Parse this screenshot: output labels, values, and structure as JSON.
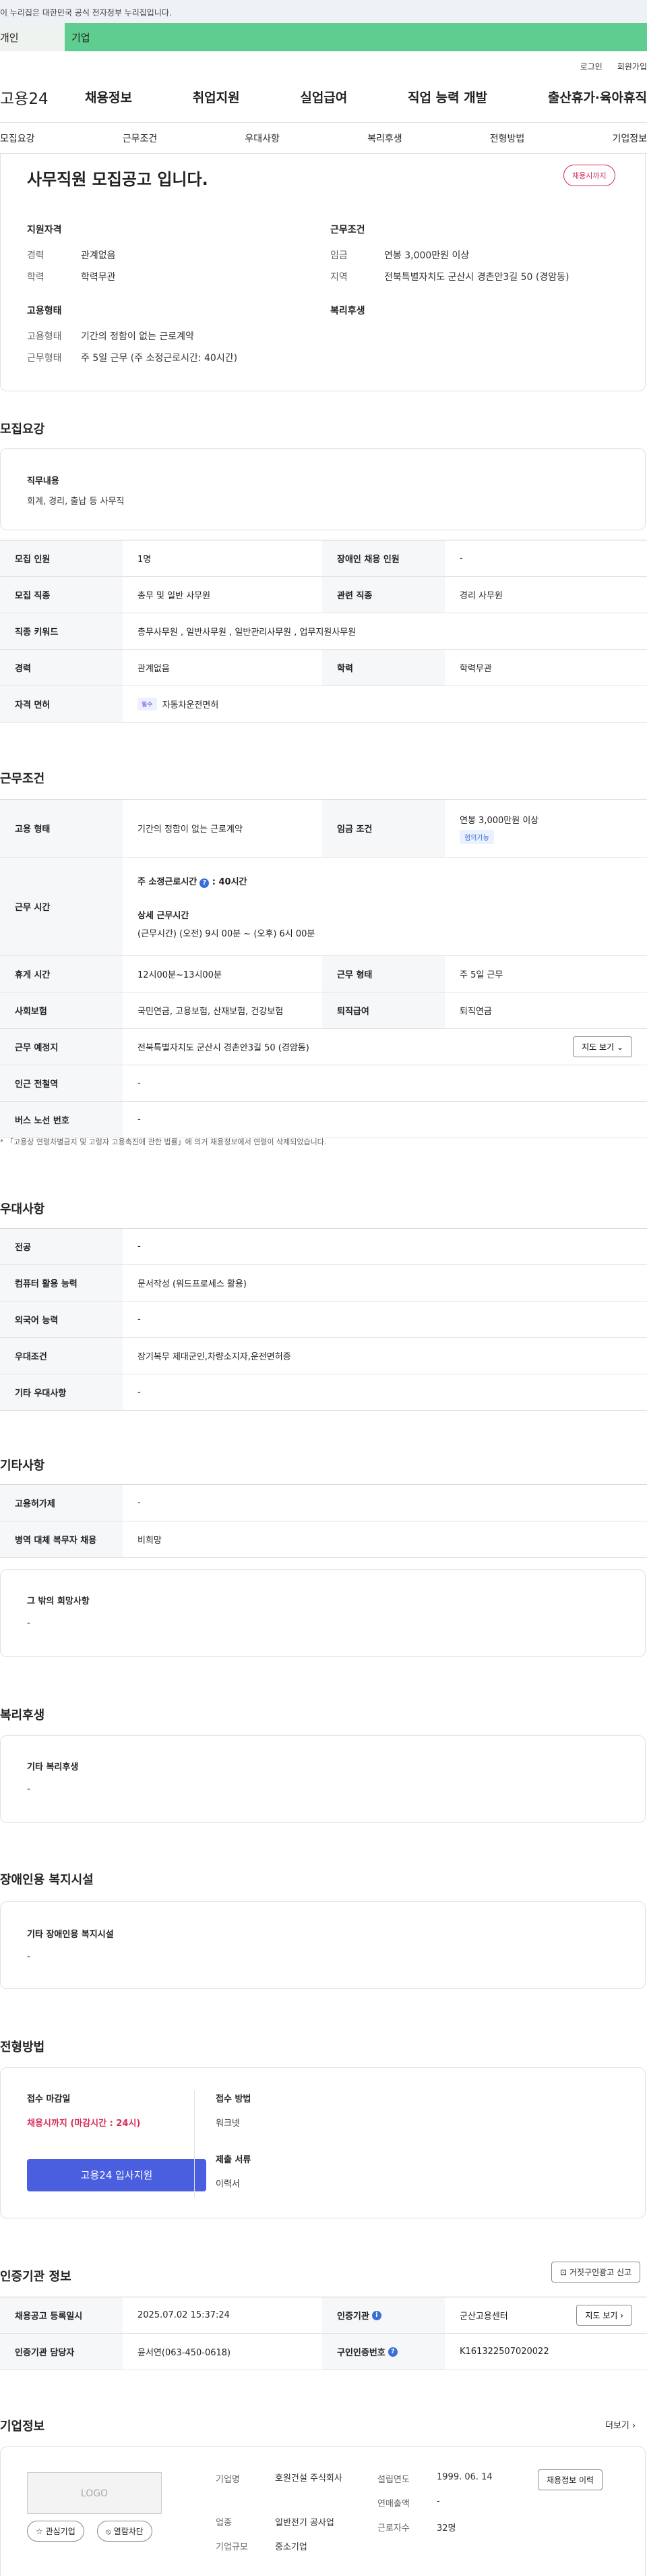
{
  "gov_banner": "이 누리집은 대한민국 공식 전자정부 누리집입니다.",
  "gov_bar": {
    "a": "개인",
    "b": "기업"
  },
  "util": {
    "login": "로그인",
    "join": "회원가입"
  },
  "gnb": {
    "logo": "고용24",
    "items": [
      "채용정보",
      "취업지원",
      "실업급여",
      "직업 능력 개발",
      "출산휴가·육아휴직"
    ]
  },
  "tabs": [
    "모집요강",
    "근무조건",
    "우대사항",
    "복리후생",
    "전형방법",
    "기업정보"
  ],
  "summary": {
    "title": "사무직원 모집공고 입니다.",
    "badge": "채용시까지",
    "qual_title": "지원자격",
    "cond_title": "근무조건",
    "career_k": "경력",
    "career_v": "관계없음",
    "edu_k": "학력",
    "edu_v": "학력무관",
    "wage_k": "임금",
    "wage_v": "연봉 3,000만원 이상",
    "region_k": "지역",
    "region_v": "전북특별자치도 군산시 경촌안3길 50 (경암동)",
    "emp_title": "고용형태",
    "welfare_title": "복리후생",
    "emptype_k": "고용형태",
    "emptype_v": "기간의 정함이 없는 근로계약",
    "worktype_k": "근무형태",
    "worktype_v": "주 5일 근무 (주 소정근로시간: 40시간)"
  },
  "recruit": {
    "heading": "모집요강",
    "duty_title": "직무내용",
    "duty_v": "회계, 경리, 출납 등 사무직",
    "rows": {
      "people_k": "모집 인원",
      "people_v": "1명",
      "disabled_k": "장애인 채용 인원",
      "disabled_v": "-",
      "job_k": "모집 직종",
      "job_v": "총무 및 일반 사무원",
      "rel_k": "관련 직종",
      "rel_v": "경리 사무원",
      "keyword_k": "직종 키워드",
      "keyword_v": "총무사무원 , 일반사무원 , 일반관리사무원 , 업무지원사무원",
      "career_k": "경력",
      "career_v": "관계없음",
      "edu_k": "학력",
      "edu_v": "학력무관",
      "license_k": "자격 면허",
      "license_pill": "필수",
      "license_v": "자동차운전면허"
    }
  },
  "work": {
    "heading": "근무조건",
    "emp_k": "고용 형태",
    "emp_v": "기간의 정함이 없는 근로계약",
    "wage_k": "임금 조건",
    "wage_v": "연봉 3,000만원 이상",
    "wage_pill": "협의가능",
    "time_k": "근무 시간",
    "time_l1": "주 소정근로시간",
    "time_l1_v": ": 40시간",
    "time_l2": "상세 근무시간",
    "time_l3": "(근무시간) (오전) 9시 00분 ~ (오후) 6시 00분",
    "rest_k": "휴게 시간",
    "rest_v": "12시00분~13시00분",
    "form_k": "근무 형태",
    "form_v": "주 5일 근무",
    "ins_k": "사회보험",
    "ins_v": "국민연금, 고용보험, 산재보험, 건강보험",
    "ret_k": "퇴직급여",
    "ret_v": "퇴직연금",
    "place_k": "근무 예정지",
    "place_v": "전북특별자치도 군산시 경촌안3길 50 (경암동)",
    "map_btn": "지도 보기",
    "subway_k": "인근 전철역",
    "subway_v": "-",
    "bus_k": "버스 노선 번호",
    "bus_v": "-",
    "note": "* 「고용상 연령차별금지 및 고령자 고용촉진에 관한 법률」에 의거 채용정보에서 연령이 삭제되었습니다."
  },
  "pref": {
    "heading": "우대사항",
    "major_k": "전공",
    "major_v": "-",
    "pc_k": "컴퓨터 활용 능력",
    "pc_v": "문서작성 (워드프로세스 활용)",
    "lang_k": "외국어 능력",
    "lang_v": "-",
    "cond_k": "우대조건",
    "cond_v": "장기복무 제대군인,차량소지자,운전면허증",
    "etc_k": "기타 우대사항",
    "etc_v": "-"
  },
  "other": {
    "heading": "기타사항",
    "permit_k": "고용허가제",
    "permit_v": "-",
    "army_k": "병역 대체 복무자 채용",
    "army_v": "비희망",
    "etc_title": "그 밖의 희망사항",
    "etc_v": "-"
  },
  "welfare": {
    "heading": "복리후생",
    "title": "기타 복리후생",
    "v": "-"
  },
  "disab": {
    "heading": "장애인용 복지시설",
    "title": "기타 장애인용 복지시설",
    "v": "-"
  },
  "process": {
    "heading": "전형방법",
    "deadline_title": "접수 마감일",
    "deadline_v": "채용시까지 (마감시간 : 24시)",
    "submit": "고용24 입사지원",
    "method_title": "접수 방법",
    "method_v": "워크넷",
    "docs_title": "제출 서류",
    "docs_v": "이력서"
  },
  "cert": {
    "heading": "인증기관 정보",
    "report_btn": "거짓구인광고 신고",
    "date_k": "채용공고 등록일시",
    "date_v": "2025.07.02 15:37:24",
    "org_k": "인증기관",
    "org_v": "군산고용센터",
    "map_btn": "지도 보기",
    "mgr_k": "인증기관 담당자",
    "mgr_v": "윤서연(063-450-0618)",
    "num_k": "구인인증번호",
    "num_v": "K161322507020022"
  },
  "company": {
    "heading": "기업정보",
    "more": "더보기",
    "logo": "LOGO",
    "interest": "관심기업",
    "block": "열람차단",
    "name_k": "기업명",
    "name_v": "호원건설 주식회사",
    "biz_k": "업종",
    "biz_v": "일반전기 공사업",
    "size_k": "기업규모",
    "size_v": "중소기업",
    "found_k": "설립연도",
    "found_v": "1999. 06. 14",
    "sales_k": "연매출액",
    "sales_v": "-",
    "emp_k": "근로자수",
    "emp_v": "32명",
    "hist_btn": "채용정보 이력"
  }
}
